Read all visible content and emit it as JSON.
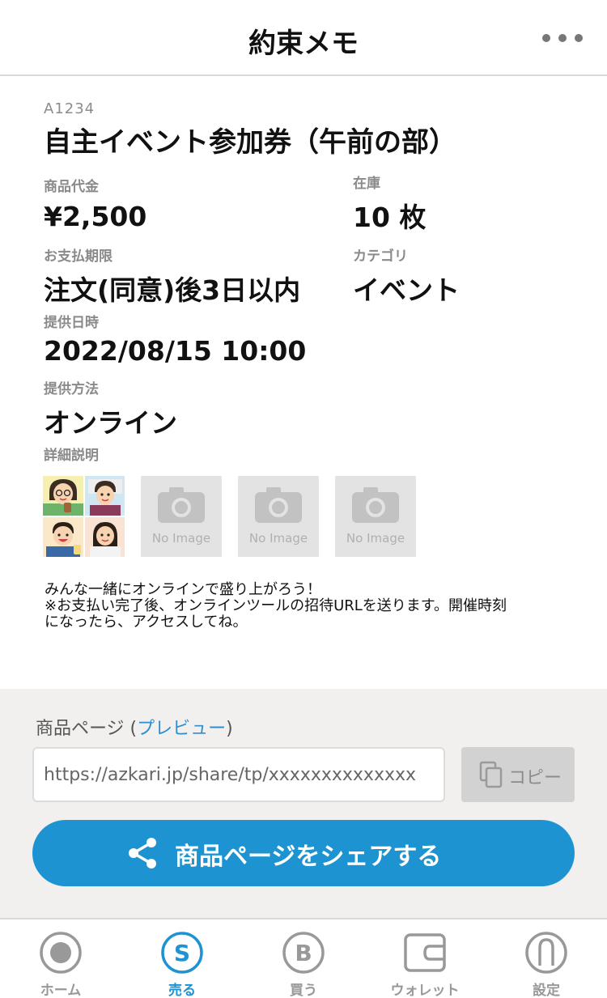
{
  "header": {
    "title": "約束メモ",
    "more_icon": "more-horizontal-icon"
  },
  "item": {
    "code": "A1234",
    "title": "自主イベント参加券（午前の部）",
    "price_label": "商品代金",
    "price": "¥2,500",
    "stock_label": "在庫",
    "stock": "10 枚",
    "payment_deadline_label": "お支払期限",
    "payment_deadline": "注文(同意)後3日以内",
    "category_label": "カテゴリ",
    "category": "イベント",
    "date_label": "提供日時",
    "date": "2022/08/15 10:00",
    "method_label": "提供方法",
    "method": "オンライン",
    "details_label": "詳細説明",
    "images": [
      {
        "type": "photo-collage"
      },
      {
        "type": "placeholder",
        "icon": "camera-icon",
        "text": "No Image"
      },
      {
        "type": "placeholder",
        "icon": "camera-icon",
        "text": "No Image"
      },
      {
        "type": "placeholder",
        "icon": "camera-icon",
        "text": "No Image"
      }
    ],
    "description": "みんな一緒にオンラインで盛り上がろう！\n※お支払い完了後、オンラインツールの招待URLを送ります。開催時刻\nになったら、アクセスしてね。"
  },
  "share": {
    "label_prefix": "商品ページ (",
    "preview_link": "プレビュー",
    "label_suffix": ")",
    "url": "https://azkari.jp/share/tp/xxxxxxxxxxxxxx",
    "copy_label": "コピー",
    "share_button": "商品ページをシェアする"
  },
  "tabbar": {
    "items": [
      {
        "label": "ホーム",
        "icon": "home-record-icon",
        "active": false
      },
      {
        "label": "売る",
        "icon": "sell-s-icon",
        "active": true
      },
      {
        "label": "買う",
        "icon": "buy-b-icon",
        "active": false
      },
      {
        "label": "ウォレット",
        "icon": "wallet-icon",
        "active": false
      },
      {
        "label": "設定",
        "icon": "settings-person-icon",
        "active": false
      }
    ]
  },
  "colors": {
    "accent": "#1e93d1",
    "share_area_bg": "#f1f0ef",
    "inactive_tab": "#999999"
  }
}
